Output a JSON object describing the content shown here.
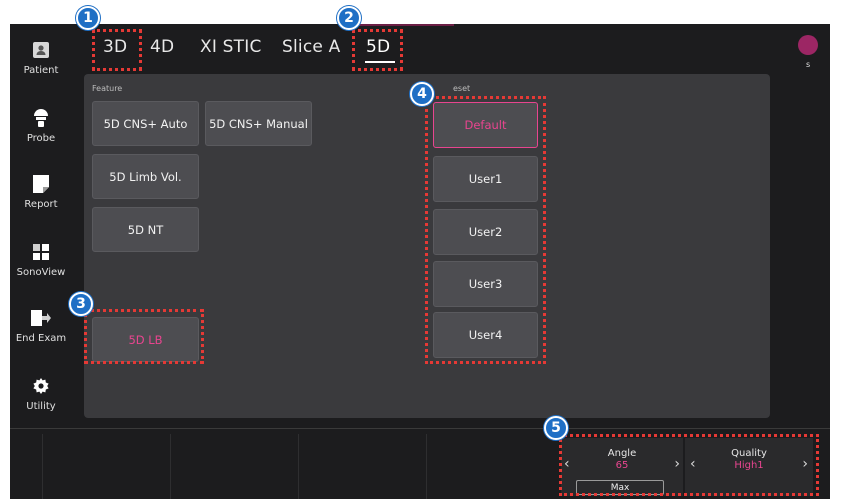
{
  "sidebar": {
    "items": [
      {
        "label": "Patient",
        "icon": "patient-icon"
      },
      {
        "label": "Probe",
        "icon": "probe-icon"
      },
      {
        "label": "Report",
        "icon": "report-icon"
      },
      {
        "label": "SonoView",
        "icon": "sonoview-icon"
      },
      {
        "label": "End Exam",
        "icon": "end-exam-icon"
      },
      {
        "label": "Utility",
        "icon": "gear-icon"
      }
    ]
  },
  "tabs": [
    {
      "label": "3D"
    },
    {
      "label": "4D"
    },
    {
      "label": "XI STIC"
    },
    {
      "label": "Slice A"
    },
    {
      "label": "5D",
      "active": true
    }
  ],
  "user": {
    "initial": "s",
    "color": "#9c2664"
  },
  "feature": {
    "label": "Feature",
    "buttons": [
      "5D CNS+ Auto",
      "5D CNS+ Manual",
      "5D Limb Vol.",
      "5D NT",
      "5D LB"
    ],
    "highlighted": "5D LB"
  },
  "preset": {
    "label": "eset",
    "buttons": [
      "Default",
      "User1",
      "User2",
      "User3",
      "User4"
    ],
    "selected": "Default"
  },
  "controls": {
    "angle": {
      "title": "Angle",
      "value": "65",
      "sub_button": "Max"
    },
    "quality": {
      "title": "Quality",
      "value": "High1"
    }
  },
  "callouts": [
    "1",
    "2",
    "3",
    "4",
    "5"
  ],
  "colors": {
    "accent": "#e8458f",
    "callout": "#e53935",
    "badge": "#1f6fc5",
    "panel": "#3a3a3d",
    "background": "#1c1c1e"
  }
}
